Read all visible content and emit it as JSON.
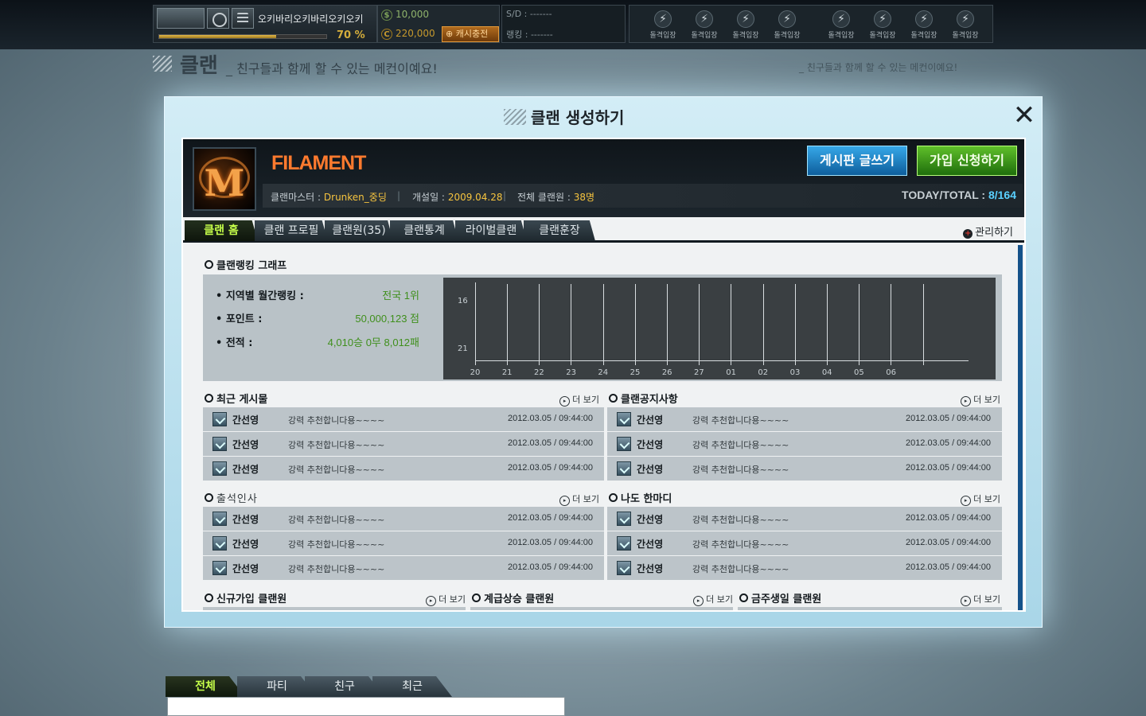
{
  "topbar": {
    "nickname": "오키바리오키바리오키오키",
    "exp_percent": 70,
    "exp_label": "70 %",
    "dollar_icon": "$",
    "dollar_value": "10,000",
    "coin_icon": "C",
    "coin_value": "220,000",
    "cash_button": "캐시충전",
    "sd_label": "S/D : -------",
    "rank_label": "랭킹 : -------",
    "quick_buttons": [
      "돌격입장",
      "돌격입장",
      "돌격입장",
      "돌격입장",
      "돌격입장",
      "돌격입장",
      "돌격입장",
      "돌격입장"
    ]
  },
  "header": {
    "title": "클랜",
    "subtitle": "_ 친구들과 함께 할 수 있는 메컨이예요!",
    "right_text": "_ 친구들과 함께 할 수 있는 메컨이예요!"
  },
  "dialog": {
    "title": "클랜 생성하기",
    "clan": {
      "name": "FILAMENT",
      "master_label": "클랜마스터 :",
      "master": "Drunken_중딩",
      "founded_label": "개설일 :",
      "founded": "2009.04.28",
      "members_label": "전체 클랜원 :",
      "members": "38명",
      "today_total_label": "TODAY/TOTAL :",
      "today_total": "8/164",
      "separator": "|"
    },
    "buttons": {
      "board": "게시판 글쓰기",
      "join": "가입 신청하기"
    },
    "tabs": [
      "클랜 홈",
      "클랜 프로필",
      "클랜원(35)",
      "클랜통계",
      "라이벌클랜",
      "클랜훈장"
    ],
    "manage": "관리하기",
    "ranking": {
      "section_title": "클랜랭킹 그래프",
      "rows": [
        {
          "label": "• 지역별 월간랭킹 :",
          "value": "전국 1위"
        },
        {
          "label": "• 포인트 :",
          "value": "50,000,123 점"
        },
        {
          "label": "• 전적 :",
          "value": "4,010승 0무 8,012패"
        }
      ]
    },
    "more_label": "더 보기",
    "boards": [
      {
        "title": "최근 게시물",
        "rows": [
          {
            "author": "간선영",
            "text": "강력 추천합니다용~~~~",
            "date": "2012.03.05 / 09:44:00"
          },
          {
            "author": "간선영",
            "text": "강력 추천합니다용~~~~",
            "date": "2012.03.05 / 09:44:00"
          },
          {
            "author": "간선영",
            "text": "강력 추천합니다용~~~~",
            "date": "2012.03.05 / 09:44:00"
          }
        ]
      },
      {
        "title": "클랜공지사항",
        "rows": [
          {
            "author": "간선영",
            "text": "강력 추천합니다용~~~~",
            "date": "2012.03.05 / 09:44:00"
          },
          {
            "author": "간선영",
            "text": "강력 추천합니다용~~~~",
            "date": "2012.03.05 / 09:44:00"
          },
          {
            "author": "간선영",
            "text": "강력 추천합니다용~~~~",
            "date": "2012.03.05 / 09:44:00"
          }
        ]
      },
      {
        "title": "출석인사",
        "rows": [
          {
            "author": "간선영",
            "text": "강력 추천합니다용~~~~",
            "date": "2012.03.05 / 09:44:00"
          },
          {
            "author": "간선영",
            "text": "강력 추천합니다용~~~~",
            "date": "2012.03.05 / 09:44:00"
          },
          {
            "author": "간선영",
            "text": "강력 추천합니다용~~~~",
            "date": "2012.03.05 / 09:44:00"
          }
        ]
      },
      {
        "title": "나도 한마디",
        "rows": [
          {
            "author": "간선영",
            "text": "강력 추천합니다용~~~~",
            "date": "2012.03.05 / 09:44:00"
          },
          {
            "author": "간선영",
            "text": "강력 추천합니다용~~~~",
            "date": "2012.03.05 / 09:44:00"
          },
          {
            "author": "간선영",
            "text": "강력 추천합니다용~~~~",
            "date": "2012.03.05 / 09:44:00"
          }
        ]
      }
    ],
    "member_sections": [
      "신규가입 클랜원",
      "계급상승 클랜원",
      "금주생일 클랜원"
    ]
  },
  "chart_data": {
    "type": "line",
    "title": "",
    "y_tick_labels": [
      "16",
      "21"
    ],
    "x": [
      "20",
      "21",
      "22",
      "23",
      "24",
      "25",
      "26",
      "27",
      "01",
      "02",
      "03",
      "04",
      "05",
      "06"
    ],
    "series": []
  },
  "chat": {
    "tabs": [
      "전체",
      "파티",
      "친구",
      "최근"
    ],
    "input_value": ""
  },
  "colors": {
    "accent_green": "#c6ff4a",
    "clan_name": "#ff7a2e",
    "board_button": "#36a7e8",
    "join_button": "#5fbf2a",
    "gold": "#f6c43f"
  }
}
